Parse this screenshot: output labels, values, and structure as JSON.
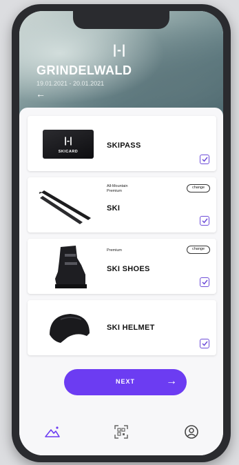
{
  "header": {
    "logo": "|-|",
    "location": "GRINDELWALD",
    "dates": "19.01.2021 - 20.01.2021"
  },
  "items": [
    {
      "title": "SKIPASS",
      "card_logo": "|-|",
      "card_text": "SKICARD",
      "checked": true
    },
    {
      "title": "SKI",
      "sub1": "All-Mountain",
      "sub2": "Premium",
      "change": "change",
      "checked": true
    },
    {
      "title": "SKI SHOES",
      "sub1": "Premium",
      "change": "change",
      "checked": true
    },
    {
      "title": "SKI HELMET",
      "checked": true
    }
  ],
  "next_button": {
    "label": "NEXT"
  },
  "icons": {
    "back": "arrow-left-icon",
    "checkbox": "checkbox-checked-icon",
    "tab_home": "mountain-icon",
    "tab_scan": "qr-scan-icon",
    "tab_profile": "user-icon",
    "next_arrow": "arrow-right-icon"
  },
  "colors": {
    "accent": "#6c3cf2",
    "check": "#6c4bd8"
  }
}
